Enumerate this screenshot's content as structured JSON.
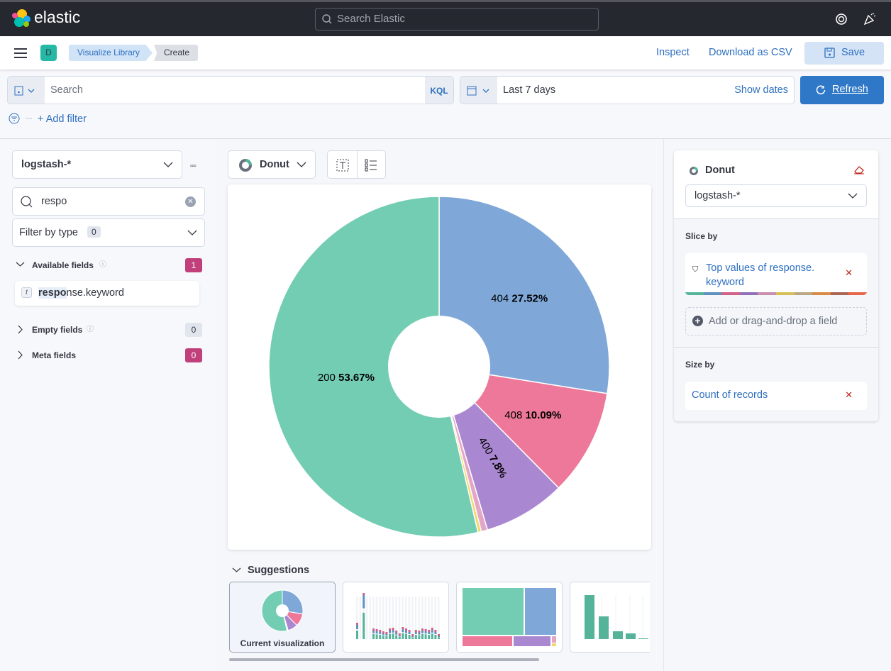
{
  "header": {
    "brand": "elastic",
    "search_placeholder": "Search Elastic",
    "space_initial": "D",
    "breadcrumbs": [
      "Visualize Library",
      "Create"
    ],
    "inspect": "Inspect",
    "download": "Download as CSV",
    "save": "Save"
  },
  "query": {
    "placeholder": "Search",
    "language": "KQL",
    "date_range": "Last 7 days",
    "show_dates": "Show dates",
    "refresh": "Refresh",
    "add_filter": "+ Add filter"
  },
  "sidebar": {
    "index_pattern": "logstash-*",
    "field_search": "respo",
    "filter_by_type": "Filter by type",
    "filter_count": "0",
    "groups": [
      {
        "label": "Available fields",
        "count": "1",
        "expanded": true
      },
      {
        "label": "Empty fields",
        "count": "0"
      },
      {
        "label": "Meta fields",
        "count": "0"
      }
    ],
    "fields": [
      {
        "type": "t",
        "match": "respo",
        "rest": "nse.keyword"
      }
    ]
  },
  "workspace": {
    "chart_type": "Donut",
    "suggestions_title": "Suggestions",
    "current_label": "Current visualization"
  },
  "config": {
    "title": "Donut",
    "index_pattern": "logstash-*",
    "slice_by": "Slice by",
    "slice_field": "Top values of response.",
    "slice_field2": "keyword",
    "add_field": "Add or drag-and-drop a field",
    "size_by": "Size by",
    "size_field": "Count of records"
  },
  "colors": {
    "accent": "#2f78c8",
    "palette": [
      "#54b399",
      "#6092c0",
      "#d36086",
      "#9170b8",
      "#ca8eae",
      "#d6bf57",
      "#b9a888",
      "#da8b45",
      "#aa6556",
      "#e7664c"
    ]
  },
  "chart_data": {
    "type": "pie",
    "donut": true,
    "slices": [
      {
        "label": "404",
        "value": 27.52,
        "color": "#7fa8d9"
      },
      {
        "label": "408",
        "value": 10.09,
        "color": "#ed7899"
      },
      {
        "label": "400",
        "value": 7.8,
        "color": "#aa87d1"
      },
      {
        "label": "",
        "value": 0.6,
        "color": "#e4a6c7"
      },
      {
        "label": "",
        "value": 0.32,
        "color": "#f1d86f"
      },
      {
        "label": "200",
        "value": 53.67,
        "color": "#73cdb3"
      }
    ]
  }
}
